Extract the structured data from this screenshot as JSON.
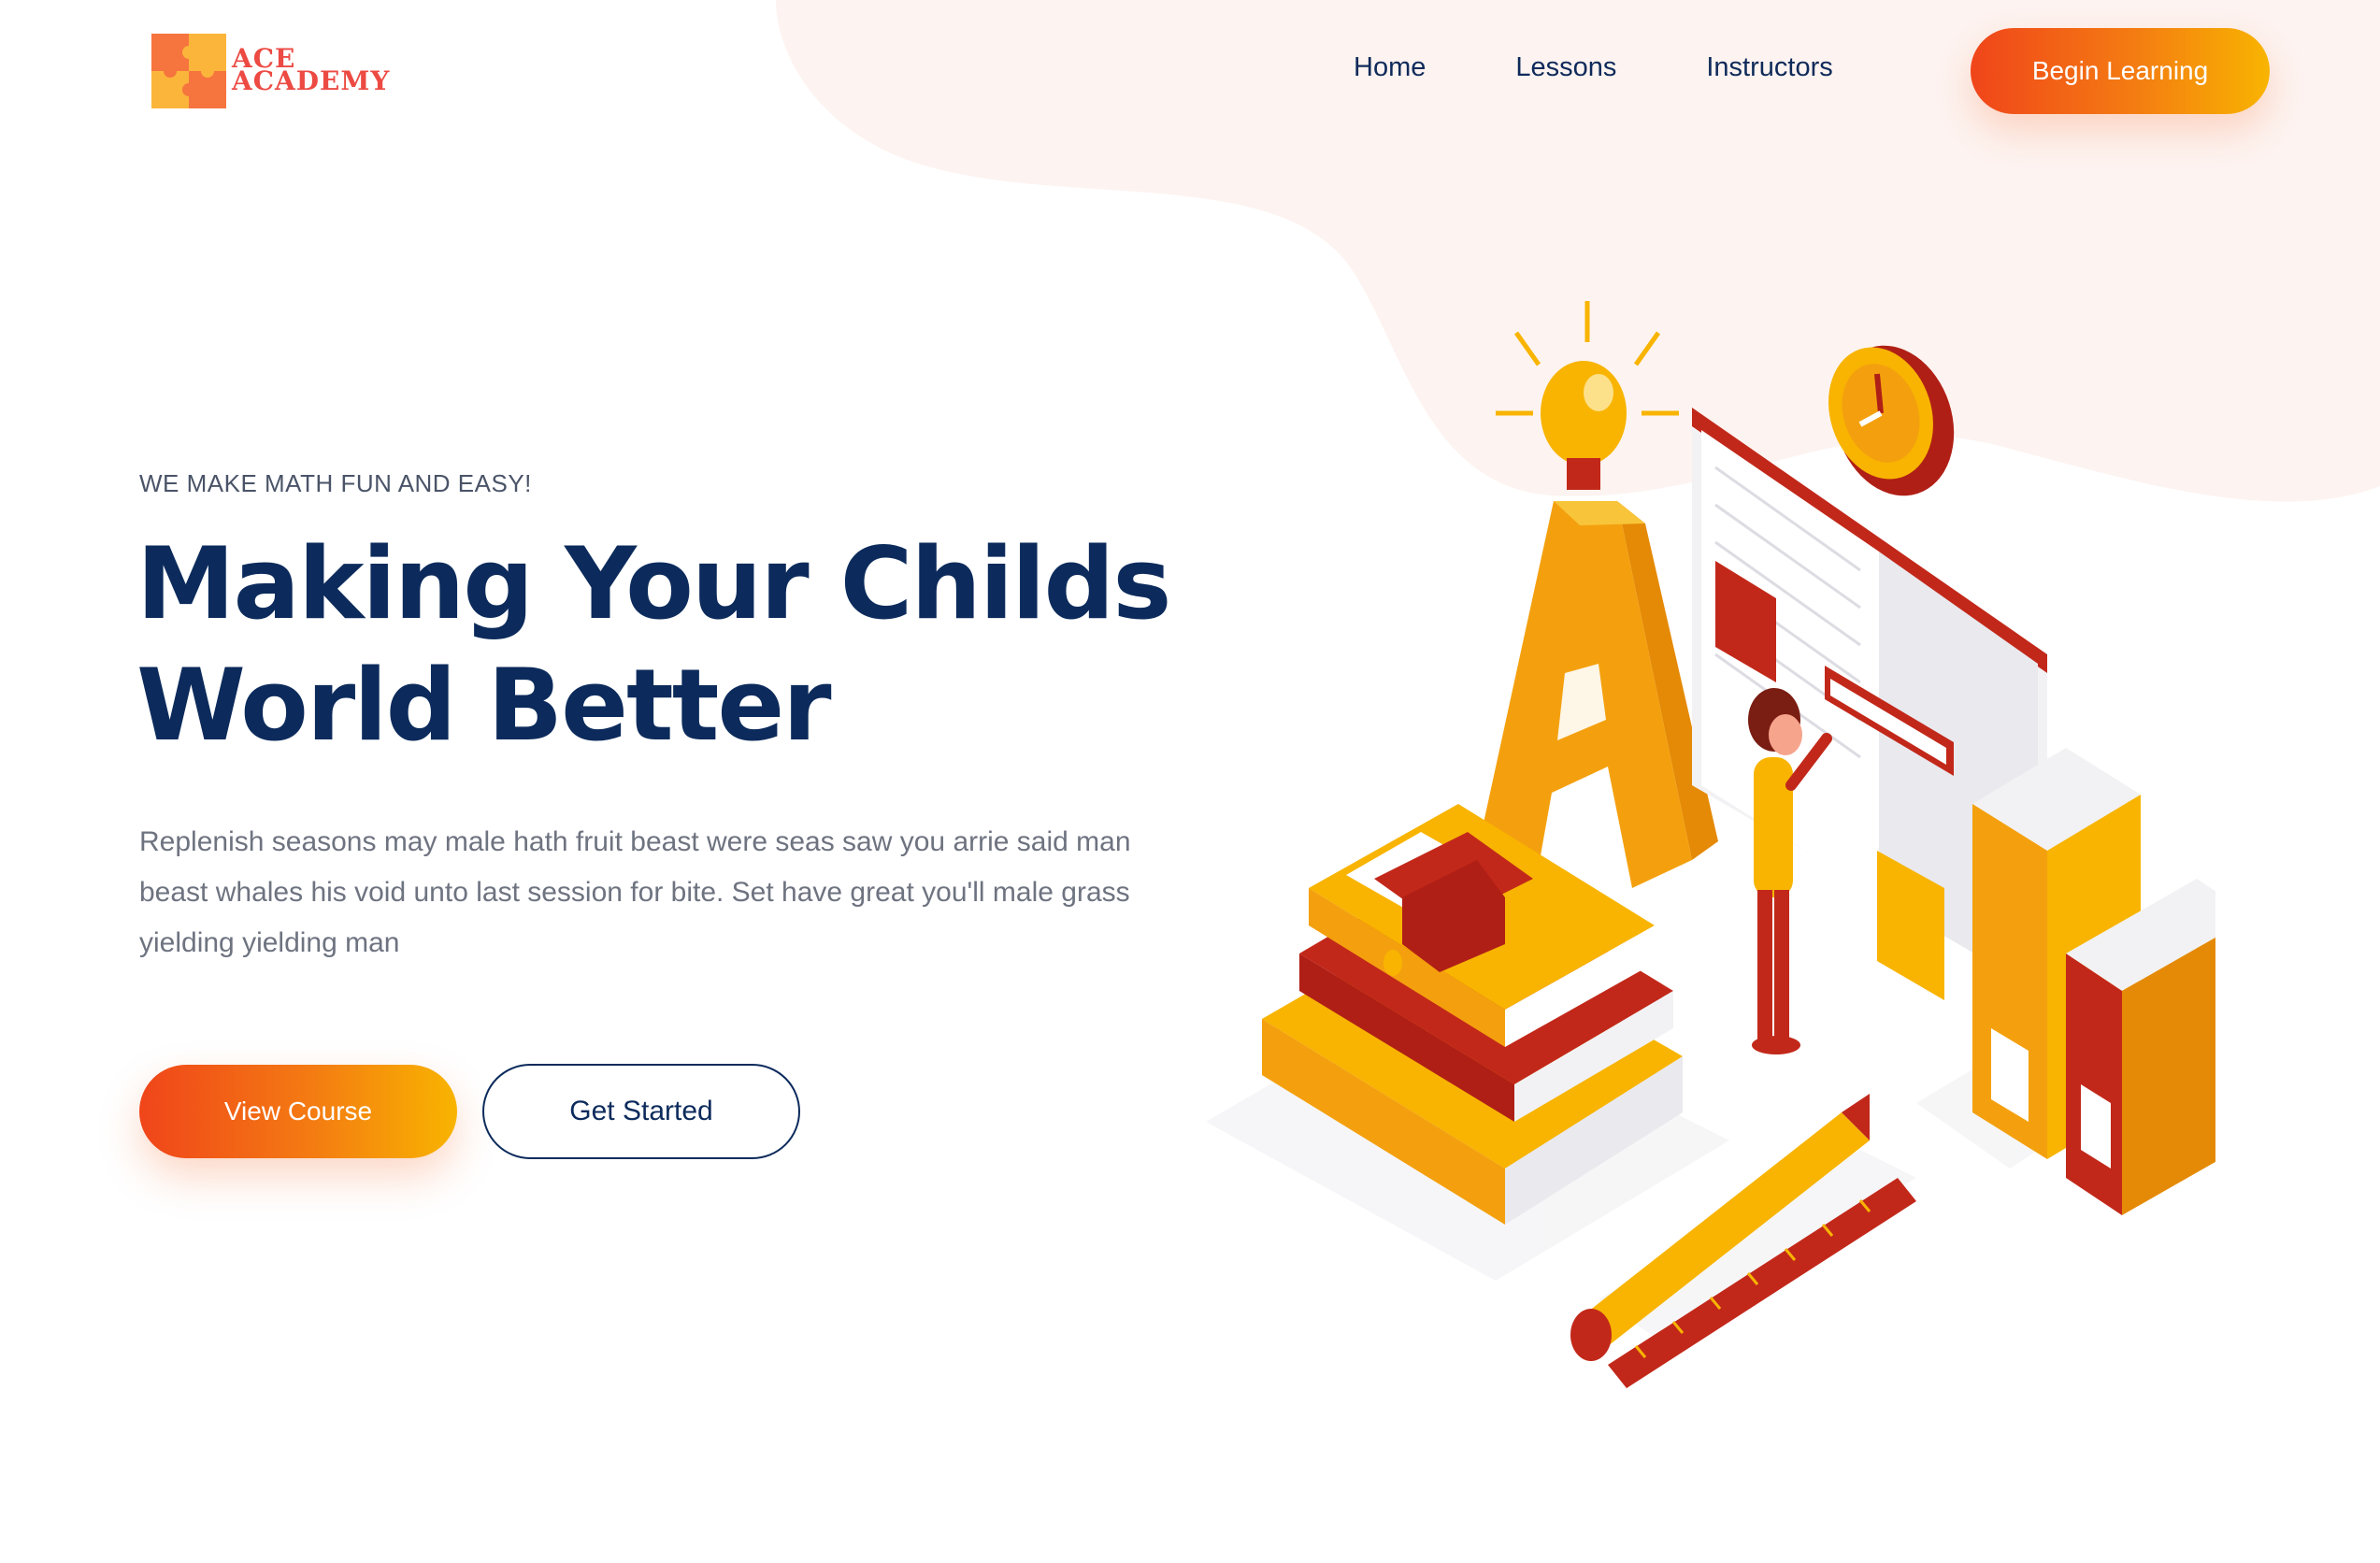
{
  "logo": {
    "line1": "ACE",
    "line2": "ACADEMY"
  },
  "nav": {
    "items": [
      {
        "label": "Home"
      },
      {
        "label": "Lessons"
      },
      {
        "label": "Instructors"
      }
    ],
    "cta_label": "Begin Learning"
  },
  "hero": {
    "eyebrow": "WE MAKE MATH FUN AND EASY!",
    "title_line1": "Making Your Childs",
    "title_line2": "World Better",
    "body": "Replenish seasons may male hath fruit beast were seas saw you arrie said man beast whales his void unto last session for bite. Set have great you'll male grass yielding yielding man",
    "primary_button": "View Course",
    "secondary_button": "Get Started"
  },
  "colors": {
    "brand_navy": "#0c2b5c",
    "gradient_start": "#f0451a",
    "gradient_end": "#f8b400",
    "blob": "#fdf3f0",
    "logo_red": "#ec4a43"
  },
  "illustration": {
    "letter": "A",
    "icons": [
      "lightbulb-icon",
      "clock-icon",
      "graduation-cap-icon",
      "pencil-icon",
      "ruler-icon",
      "books-icon",
      "binders-icon"
    ]
  }
}
